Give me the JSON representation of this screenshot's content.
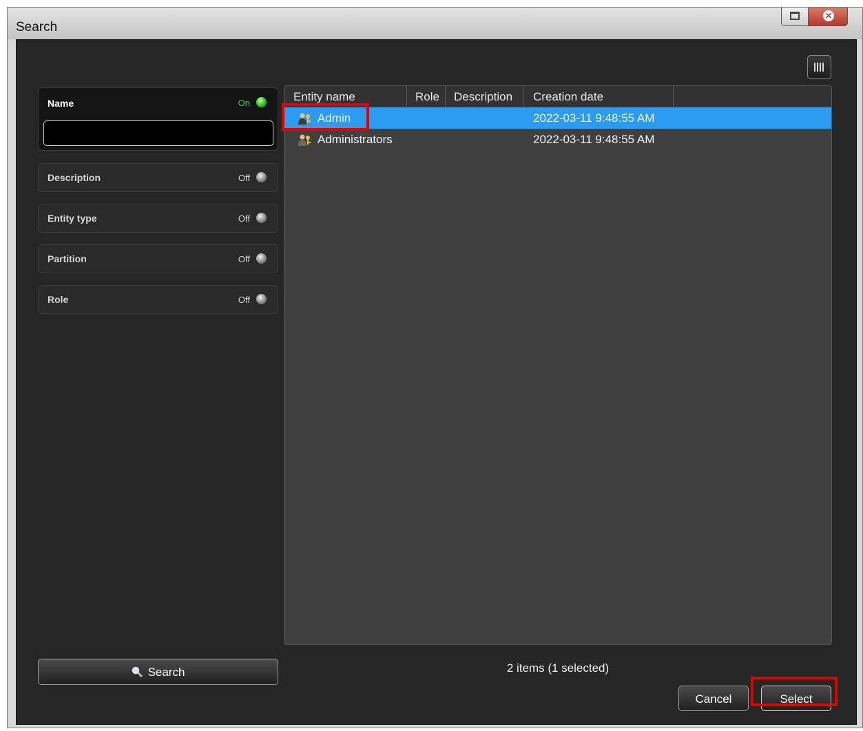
{
  "window": {
    "title": "Search"
  },
  "filters": [
    {
      "label": "Name",
      "state": "On",
      "input_value": ""
    },
    {
      "label": "Description",
      "state": "Off"
    },
    {
      "label": "Entity type",
      "state": "Off"
    },
    {
      "label": "Partition",
      "state": "Off"
    },
    {
      "label": "Role",
      "state": "Off"
    }
  ],
  "results": {
    "columns": [
      "Entity name",
      "Role",
      "Description",
      "Creation date"
    ],
    "rows": [
      {
        "name": "Admin",
        "role": "",
        "description": "",
        "creation_date": "2022-03-11 9:48:55 AM",
        "selected": true,
        "icon": "user-group-icon"
      },
      {
        "name": "Administrators",
        "role": "",
        "description": "",
        "creation_date": "2022-03-11 9:48:55 AM",
        "selected": false,
        "icon": "user-group-icon"
      }
    ],
    "status": "2 items (1 selected)"
  },
  "buttons": {
    "search": "Search",
    "cancel": "Cancel",
    "select": "Select"
  },
  "colors": {
    "selection": "#2c9cf0",
    "active_indicator": "#36d13a",
    "highlight": "#e30000"
  }
}
